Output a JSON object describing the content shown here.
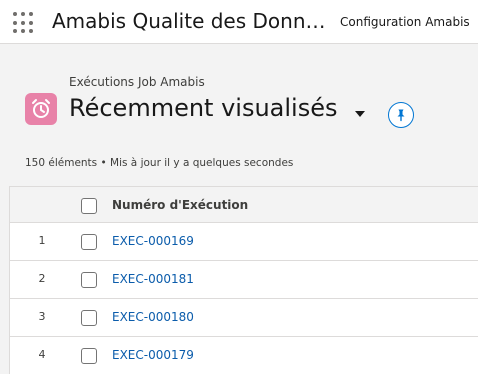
{
  "topbar": {
    "app_launcher_icon": "app-launcher-waffle-icon",
    "app_name": "Amabis Qualite des Donn…",
    "nav_item": "Configuration Amabis"
  },
  "header": {
    "object_label": "Exécutions Job Amabis",
    "object_icon": "alarm-clock-icon",
    "list_view_title": "Récemment visualisés",
    "pin_icon": "pin-icon",
    "status_text": "150 éléments • Mis à jour il y a quelques secondes"
  },
  "table": {
    "column_header": "Numéro d'Exécution",
    "rows": [
      {
        "num": "1",
        "name": "EXEC-000169"
      },
      {
        "num": "2",
        "name": "EXEC-000181"
      },
      {
        "num": "3",
        "name": "EXEC-000180"
      },
      {
        "num": "4",
        "name": "EXEC-000179"
      }
    ]
  },
  "colors": {
    "link": "#0b5cab",
    "object_icon_bg": "#e882a8",
    "pin_border": "#0176d3"
  }
}
